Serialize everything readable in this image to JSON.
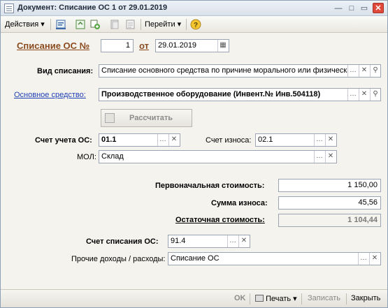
{
  "window": {
    "title": "Документ: Списание ОС 1 от 29.01.2019"
  },
  "toolbar": {
    "actions_label": "Действия",
    "goto_label": "Перейти",
    "help_icon": "?"
  },
  "header": {
    "doc_title": "Списание ОС №",
    "number_value": "1",
    "date_prefix": "от",
    "date_value": "29.01.2019"
  },
  "form": {
    "write_off_type_label": "Вид списания:",
    "write_off_type_value": "Списание основного средства по причине морального или физическ",
    "asset_label": "Основное средство:",
    "asset_value": "Производственное оборудование (Инвент.№ Инв.504118)",
    "calc_button_label": "Рассчитать",
    "account_label": "Счет учета ОС:",
    "account_value": "01.1",
    "depr_account_label": "Счет износа:",
    "depr_account_value": "02.1",
    "mol_label": "МОЛ:",
    "mol_value": "Склад",
    "initial_cost_label": "Первоначальная стоимость:",
    "initial_cost_value": "1 150,00",
    "depreciation_label": "Сумма износа:",
    "depreciation_value": "45,56",
    "residual_label": "Остаточная стоимость:",
    "residual_value": "1 104,44",
    "writeoff_account_label": "Счет списания ОС:",
    "writeoff_account_value": "91.4",
    "other_label": "Прочие доходы / расходы:",
    "other_value": "Списание ОС"
  },
  "footer": {
    "ok_label": "OK",
    "print_label": "Печать",
    "save_label": "Записать",
    "close_label": "Закрыть"
  }
}
